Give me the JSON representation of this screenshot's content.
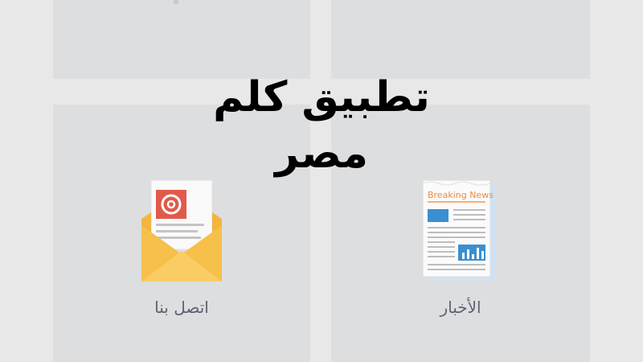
{
  "app": {
    "title": "تطبيق كلم مصر"
  },
  "tiles": [
    {
      "label": "اتصل بنا",
      "icon": "envelope-email-icon"
    },
    {
      "label": "الأخبار",
      "icon": "breaking-news-newspaper-icon",
      "icon_text": "Breaking News"
    }
  ],
  "colors": {
    "background": "#e8e8e9",
    "tile": "#dddee0",
    "label": "#5d6370",
    "envelope": "#f7c04a",
    "email_badge": "#e05a4a",
    "news_accent": "#f08a3c",
    "news_blue": "#3a8fd0"
  }
}
